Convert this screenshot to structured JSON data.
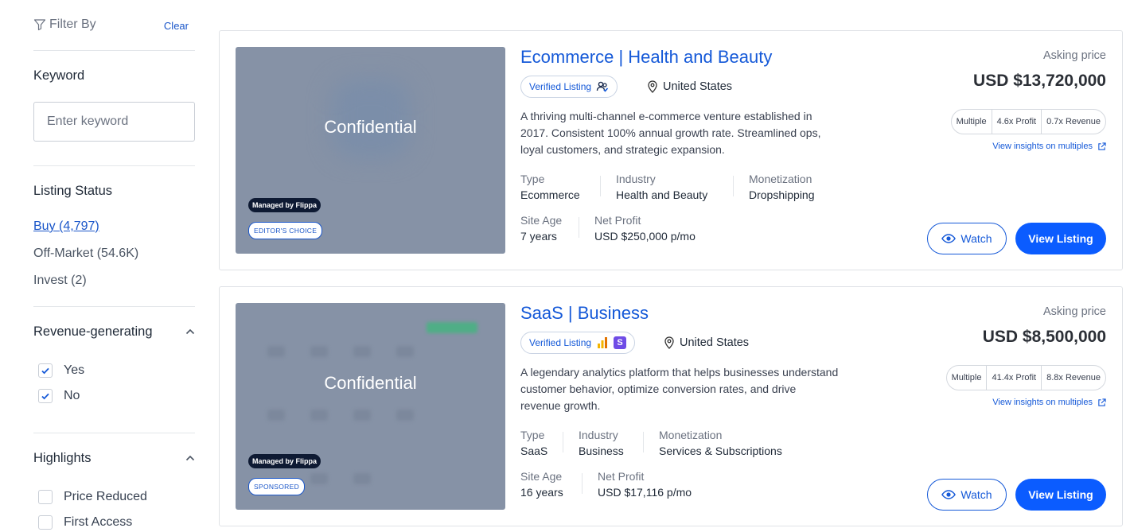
{
  "filter": {
    "title": "Filter By",
    "clear": "Clear"
  },
  "keyword": {
    "title": "Keyword",
    "placeholder": "Enter keyword"
  },
  "listing_status": {
    "title": "Listing Status",
    "items": [
      "Buy (4,797)",
      "Off-Market (54.6K)",
      "Invest (2)"
    ]
  },
  "revenue": {
    "title": "Revenue-generating",
    "options": [
      {
        "label": "Yes",
        "checked": true
      },
      {
        "label": "No",
        "checked": true
      }
    ]
  },
  "highlights": {
    "title": "Highlights",
    "options": [
      {
        "label": "Price Reduced",
        "checked": false
      },
      {
        "label": "First Access",
        "checked": false
      }
    ]
  },
  "listings": [
    {
      "thumb_text": "Confidential",
      "managed_badge": "Managed by Flippa",
      "second_badge": "EDITOR'S CHOICE",
      "title": "Ecommerce | Health and Beauty",
      "verified": "Verified Listing",
      "location": "United States",
      "description": "A thriving multi-channel e-commerce venture established in 2017. Consistent 100% annual growth rate. Streamlined ops, loyal customers, and strategic expansion.",
      "type_label": "Type",
      "type": "Ecommerce",
      "industry_label": "Industry",
      "industry": "Health and Beauty",
      "monetization_label": "Monetization",
      "monetization": "Dropshipping",
      "site_age_label": "Site Age",
      "site_age": "7 years",
      "net_profit_label": "Net Profit",
      "net_profit": "USD $250,000 p/mo",
      "asking_label": "Asking price",
      "price": "USD $13,720,000",
      "multiple_label": "Multiple",
      "profit_multiple": "4.6x Profit",
      "revenue_multiple": "0.7x Revenue",
      "insights": "View insights on multiples",
      "watch": "Watch",
      "view": "View Listing"
    },
    {
      "thumb_text": "Confidential",
      "managed_badge": "Managed by Flippa",
      "second_badge": "SPONSORED",
      "title": "SaaS | Business",
      "verified": "Verified Listing",
      "location": "United States",
      "description": "A legendary analytics platform that helps businesses understand customer behavior, optimize conversion rates, and drive revenue growth.",
      "type_label": "Type",
      "type": "SaaS",
      "industry_label": "Industry",
      "industry": "Business",
      "monetization_label": "Monetization",
      "monetization": "Services & Subscriptions",
      "site_age_label": "Site Age",
      "site_age": "16 years",
      "net_profit_label": "Net Profit",
      "net_profit": "USD $17,116 p/mo",
      "asking_label": "Asking price",
      "price": "USD $8,500,000",
      "multiple_label": "Multiple",
      "profit_multiple": "41.4x Profit",
      "revenue_multiple": "8.8x Revenue",
      "insights": "View insights on multiples",
      "watch": "Watch",
      "view": "View Listing"
    }
  ],
  "colors": {
    "link": "#1559d8",
    "primary_button": "#0b5cff",
    "thumb_bg": "#8692a6"
  }
}
